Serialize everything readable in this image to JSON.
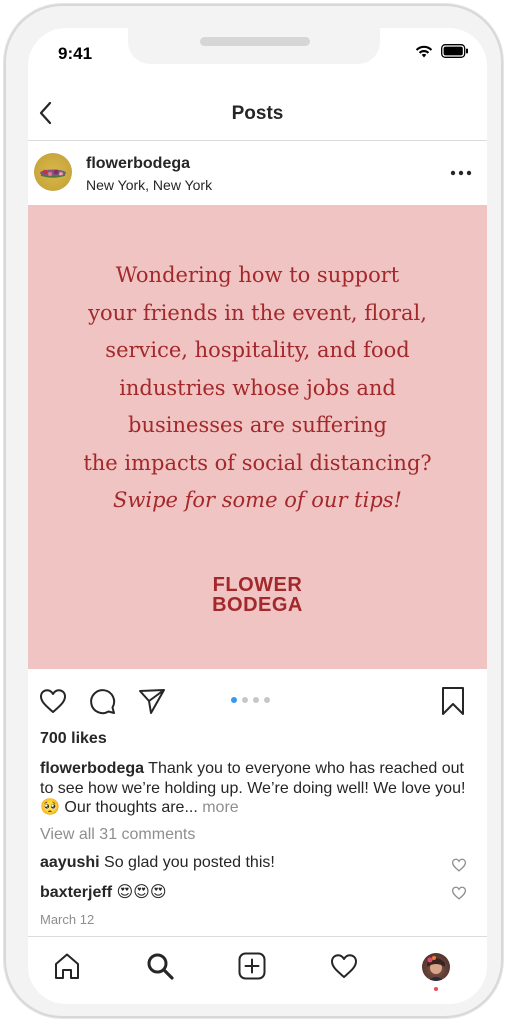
{
  "status": {
    "time": "9:41"
  },
  "nav": {
    "title": "Posts"
  },
  "post": {
    "username": "flowerbodega",
    "location": "New York, New York",
    "image_lines": [
      "Wondering how to support",
      "your friends in the event, floral,",
      "service, hospitality, and food",
      "industries whose jobs and",
      "businesses are suffering",
      "the impacts of social distancing?"
    ],
    "image_tip": "Swipe for some of our tips!",
    "brand_line1": "FLOWER",
    "brand_line2": "BODEGA",
    "carousel": {
      "count": 4,
      "active_index": 0
    },
    "likes": "700 likes",
    "caption_user": "flowerbodega",
    "caption_text": " Thank you to everyone who has reached out to see how we’re holding up. We’re doing well! We love you! 🥺 Our thoughts are...",
    "caption_more": " more",
    "view_all": "View all 31 comments",
    "comments": [
      {
        "user": "aayushi",
        "text": " So glad you posted this!"
      },
      {
        "user": "baxterjeff",
        "text": " 😍😍😍"
      }
    ],
    "date": "March 12"
  },
  "colors": {
    "image_bg": "#efc4c3",
    "image_text": "#a3282b",
    "accent_blue": "#3897f0",
    "muted": "#8e8e8e",
    "notification_red": "#ed4956"
  },
  "icons": {
    "nav": [
      "back-chevron-icon"
    ],
    "actions": [
      "heart-icon",
      "comment-icon",
      "share-icon",
      "bookmark-icon"
    ],
    "tabs": [
      "home-icon",
      "search-icon",
      "add-post-icon",
      "activity-heart-icon",
      "profile-avatar"
    ]
  }
}
